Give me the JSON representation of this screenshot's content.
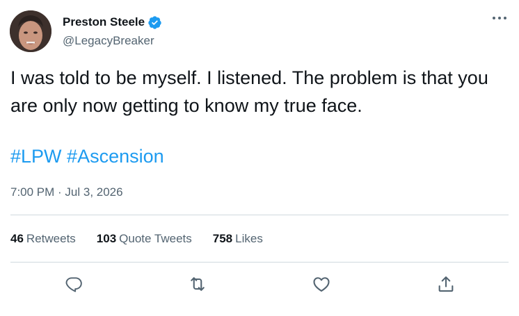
{
  "author": {
    "display_name": "Preston Steele",
    "handle": "@LegacyBreaker",
    "verified_icon": "verified-badge-icon",
    "verified_color": "#1d9bf0"
  },
  "tweet": {
    "text": "I was told to be myself. I listened. The problem is that you are only now getting to know my true face.",
    "hashtags": [
      "#LPW",
      "#Ascension"
    ],
    "timestamp": "7:00 PM · Jul 3, 2026"
  },
  "stats": [
    {
      "count": "46",
      "label": "Retweets"
    },
    {
      "count": "103",
      "label": "Quote Tweets"
    },
    {
      "count": "758",
      "label": "Likes"
    }
  ],
  "actions": [
    {
      "icon": "reply-icon"
    },
    {
      "icon": "retweet-icon"
    },
    {
      "icon": "like-icon"
    },
    {
      "icon": "share-icon"
    }
  ],
  "colors": {
    "text_primary": "#0f1419",
    "text_secondary": "#536471",
    "link": "#1d9bf0",
    "divider": "#cfd9de"
  }
}
